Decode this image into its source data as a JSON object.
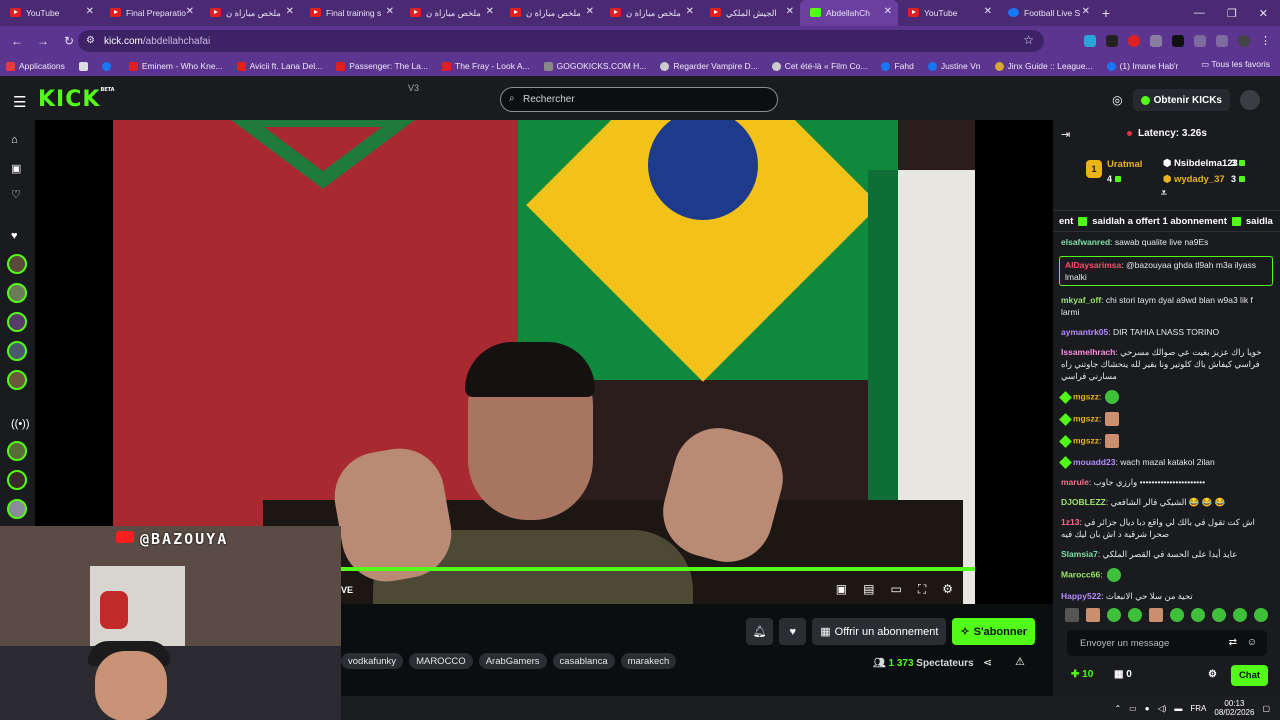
{
  "browser": {
    "tabs": [
      {
        "title": "YouTube",
        "icon": "youtube-icon"
      },
      {
        "title": "Final Preparatio",
        "icon": "youtube-icon"
      },
      {
        "title": "ملخص مباراة ن",
        "icon": "youtube-icon"
      },
      {
        "title": "Final training s",
        "icon": "youtube-icon"
      },
      {
        "title": "ملخص مباراة ن",
        "icon": "youtube-icon"
      },
      {
        "title": "ملخص مباراة ن",
        "icon": "youtube-icon"
      },
      {
        "title": "ملخص مباراة ن",
        "icon": "youtube-icon"
      },
      {
        "title": "الجيش الملكي",
        "icon": "youtube-icon"
      },
      {
        "title": "AbdellahCh",
        "icon": "kick-icon"
      },
      {
        "title": "YouTube",
        "icon": "youtube-icon"
      },
      {
        "title": "Football Live S",
        "icon": "facebook-icon"
      }
    ],
    "url_host": "kick.com",
    "url_path": "/abdellahchafai",
    "bookmarks": [
      {
        "label": "Applications",
        "icon": "apps-grid-icon"
      },
      {
        "label": "",
        "icon": "facebook-icon"
      },
      {
        "label": "Eminem - Who Kne...",
        "icon": "youtube-icon"
      },
      {
        "label": "Avicii ft. Lana Del...",
        "icon": "youtube-icon"
      },
      {
        "label": "Passenger: The La...",
        "icon": "youtube-icon"
      },
      {
        "label": "The Fray - Look A...",
        "icon": "youtube-icon"
      },
      {
        "label": "GOGOKICKS.COM H...",
        "icon": "globe-icon"
      },
      {
        "label": "Regarder Vampire D...",
        "icon": "globe-icon"
      },
      {
        "label": "Cet été-là « Film Co...",
        "icon": "globe-icon"
      },
      {
        "label": "Fahd",
        "icon": "facebook-icon"
      },
      {
        "label": "Justine Vn",
        "icon": "facebook-icon"
      },
      {
        "label": "Jinx Guide :: League...",
        "icon": "globe-icon"
      },
      {
        "label": "(1) Imane Hab'r",
        "icon": "facebook-icon"
      }
    ],
    "bookmarks_right": "Tous les favoris"
  },
  "header": {
    "logo": "KICK",
    "logo_beta": "BETA",
    "version_tag": "V3",
    "search_placeholder": "Rechercher",
    "kicks_button": "Obtenir KICKs"
  },
  "player": {
    "live_label": "VE"
  },
  "webcam": {
    "handle": "@BAZOUYA"
  },
  "below": {
    "tags": [
      "vodkafunky",
      "MAROCCO",
      "ArabGamers",
      "casablanca",
      "marakech"
    ],
    "gift_button": "Offrir un abonnement",
    "subscribe_button": "S'abonner",
    "viewers_count": "1 373",
    "viewers_label": "Spectateurs"
  },
  "chat": {
    "latency": "Latency: 3.26s",
    "leaderboard": [
      {
        "rank": "1",
        "name": "Uratmal",
        "count": "4"
      },
      {
        "name": "Nsibdelma123",
        "count": "3"
      },
      {
        "name": "wydady_37",
        "count": "3"
      }
    ],
    "pinned_prefix": "ent",
    "pinned_user": "saidlah",
    "pinned_text": "a offert 1 abonnement",
    "pinned_tail": "saidla",
    "messages": [
      {
        "user": "elsafwanred",
        "color": "#7ee0a8",
        "text": ": sawab qualite live na9Es"
      },
      {
        "user": "AlDaysarimsa",
        "color": "#ff4d6a",
        "text": ": @bazouyaa ghda tl9ah m3a ilyass lmalki",
        "highlight": true
      },
      {
        "user": "mkyaf_off",
        "color": "#9be66a",
        "text": ": chi stori taym dyal a9wd blan w9a3 lik f larmi"
      },
      {
        "user": "aymantrk05",
        "color": "#b68cff",
        "text": ": DIR TAHIA LNASS TORINO"
      },
      {
        "user": "Issamelhrach",
        "color": "#ff8be0",
        "text": ": خويا راك عزيز بغيت عي صوالك مسرحي فراسي كيفاش باك كلوتير ونا بقير لله ينحشاك جاوتني راه مسارني فراسي"
      },
      {
        "user": "mgszz",
        "color": "#e8b31b",
        "text": ":",
        "badge": true,
        "emote": "green"
      },
      {
        "user": "mgszz",
        "color": "#e8b31b",
        "text": ":",
        "badge": true,
        "emote": "face"
      },
      {
        "user": "mgszz",
        "color": "#e8b31b",
        "text": ":",
        "badge": true,
        "emote": "face"
      },
      {
        "user": "mouadd23",
        "color": "#b68cff",
        "text": ": wach mazal katakol 2ilan",
        "badge": true
      },
      {
        "user": "marule",
        "color": "#ff6b8b",
        "text": ": وارزي جاوب ••••••••••••••••••••••"
      },
      {
        "user": "DJOBLEZZ",
        "color": "#9be66a",
        "text": ": الشيكي فالر الشافعي 😂 😂 😂"
      },
      {
        "user": "1z13",
        "color": "#ff6b8b",
        "text": ": اش كت تقول في بالك لي واقع دبا ديال جزائر في صحرا شرقية د اش بان ليك فيه"
      },
      {
        "user": "Slamsia7",
        "color": "#7ee0a8",
        "text": ": عايد أيدا على الحسة في القصر الملكي"
      },
      {
        "user": "Marocc66",
        "color": "#9be66a",
        "text": ":",
        "emote": "green"
      },
      {
        "user": "Happy522",
        "color": "#b68cff",
        "text": ": تحية من سلا حي الانبعاث"
      }
    ],
    "input_placeholder": "Envoyer un message",
    "points": "10",
    "gifts": "0",
    "chat_button": "Chat"
  },
  "taskbar": {
    "lang": "FRA",
    "time": "00:13",
    "date": "08/02/2026"
  },
  "colors": {
    "kick_green": "#53fc18",
    "chrome_purple": "#5c3590"
  }
}
